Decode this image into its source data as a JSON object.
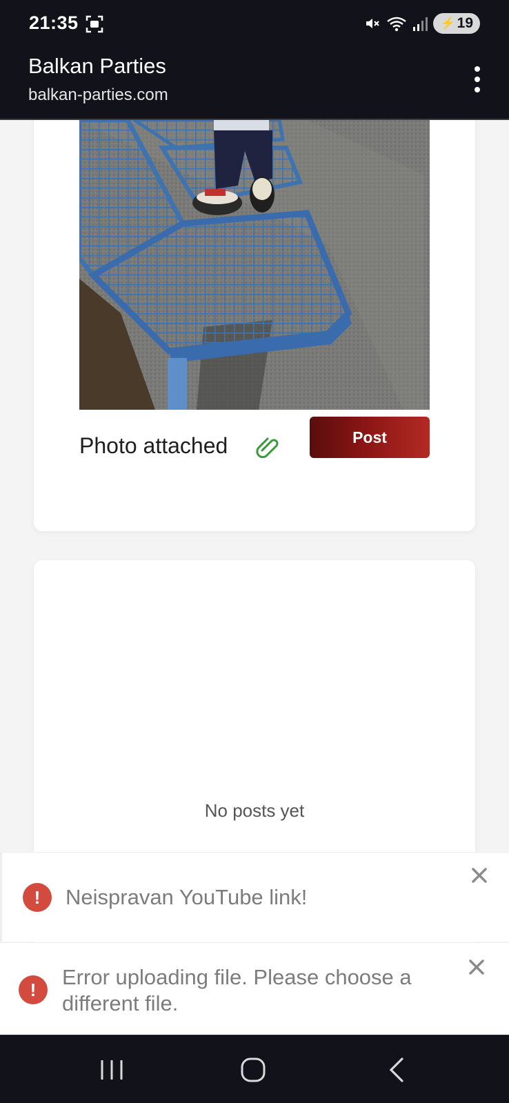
{
  "status_bar": {
    "time": "21:35",
    "battery": "19",
    "icons": [
      "screenshot-icon",
      "mute-icon",
      "wifi-icon",
      "signal-icon",
      "battery-saver-icon"
    ]
  },
  "browser": {
    "title": "Balkan Parties",
    "url": "balkan-parties.com",
    "menu_icon": "more-vert-icon"
  },
  "compose": {
    "photo_label": "Photo attached",
    "attach_icon": "paperclip-icon",
    "post_label": "Post"
  },
  "posts": {
    "empty_text": "No posts yet"
  },
  "toasts": [
    {
      "message": "Neispravan YouTube link!",
      "icon": "error-icon",
      "close_icon": "close-icon"
    },
    {
      "message": "Error uploading file. Please choose a different file.",
      "icon": "error-icon",
      "close_icon": "close-icon"
    }
  ],
  "colors": {
    "post_button_start": "#5a0d0d",
    "post_button_end": "#b32a22",
    "error": "#d24b3e",
    "paperclip": "#3a9a3a",
    "bench": "#3f73b0"
  },
  "nav_bar": {
    "icons": [
      "recents-icon",
      "home-icon",
      "back-icon"
    ]
  }
}
